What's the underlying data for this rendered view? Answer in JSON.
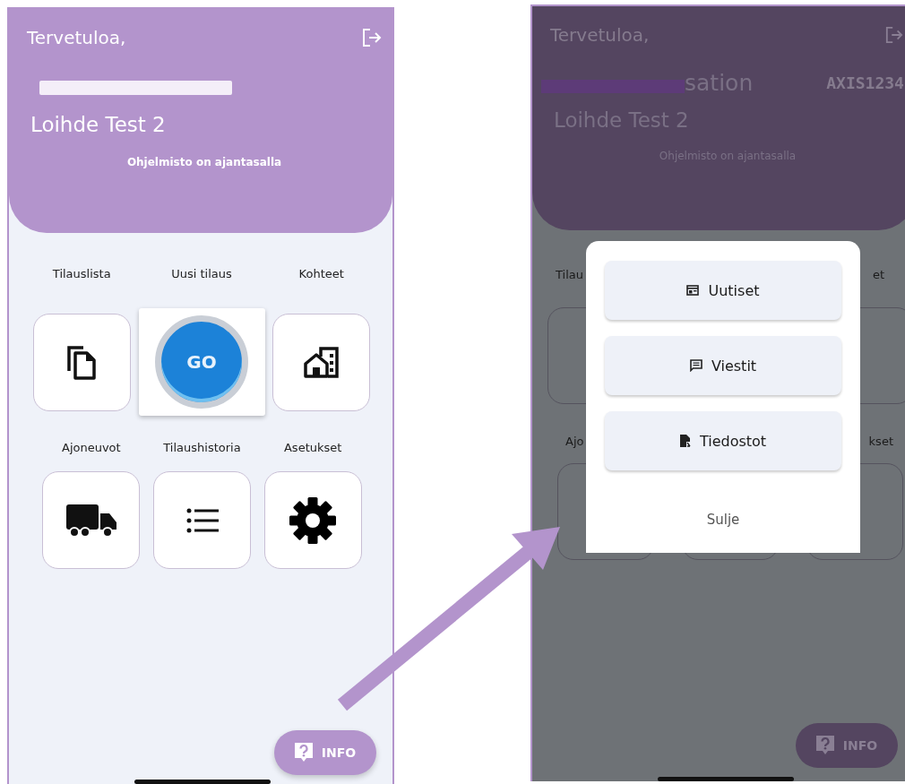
{
  "home_screen": {
    "greeting": "Tervetuloa,",
    "organization_redacted": true,
    "site": "Loihde Test 2",
    "status": "Ohjelmisto on ajantasalla",
    "tile_rows": [
      {
        "tiles": [
          {
            "label": "Tilauslista",
            "kind": "copy"
          },
          {
            "label": "Uusi tilaus",
            "kind": "go",
            "button": "GO"
          },
          {
            "label": "Kohteet",
            "kind": "building"
          }
        ]
      },
      {
        "tiles": [
          {
            "label": "Ajoneuvot",
            "kind": "truck"
          },
          {
            "label": "Tilaushistoria",
            "kind": "list"
          },
          {
            "label": "Asetukset",
            "kind": "gear"
          }
        ]
      }
    ],
    "info_button": "INFO"
  },
  "info_dialog_screen": {
    "greeting": "Tervetuloa,",
    "organization_visible_part": "sation",
    "organization_redacted": true,
    "code": "AXIS1234",
    "site": "Loihde Test 2",
    "status": "Ohjelmisto on ajantasalla",
    "tile_label_fragments": [
      {
        "left": "Tilau",
        "right": "et"
      },
      {
        "left": "Ajo",
        "right": "kset"
      }
    ],
    "dialog": {
      "options": [
        {
          "label": "Uutiset",
          "kind": "news"
        },
        {
          "label": "Viestit",
          "kind": "message"
        },
        {
          "label": "Tiedostot",
          "kind": "file"
        }
      ],
      "close": "Sulje"
    },
    "info_button": "INFO"
  }
}
